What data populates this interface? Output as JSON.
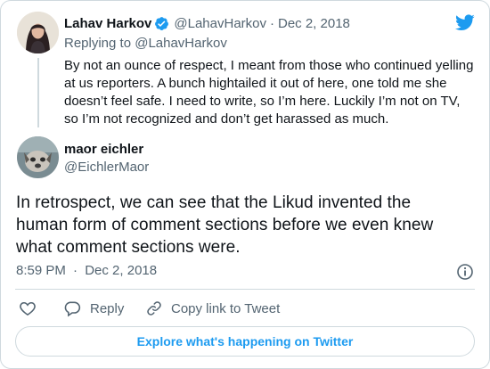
{
  "colors": {
    "verified_badge": "#1d9bf0",
    "twitter_blue": "#1d9bf0",
    "text_primary": "#0f1419",
    "text_muted": "#536471",
    "border": "#cfd9de"
  },
  "parent_tweet": {
    "author_name": "Lahav Harkov",
    "author_handle": "@LahavHarkov",
    "separator": "·",
    "date": "Dec 2, 2018",
    "replying_to": "Replying to @LahavHarkov",
    "text": "By not an ounce of respect, I meant from those who continued yelling at us reporters. A bunch hightailed it out of here, one told me she doesn’t feel safe. I need to write, so I’m here. Luckily I’m not on TV, so I’m not recognized and don’t get harassed as much."
  },
  "main_tweet": {
    "author_name": "maor eichler",
    "author_handle": "@EichlerMaor",
    "text": "In retrospect, we can see that the Likud invented the human form of comment sections before we even knew what comment sections were.",
    "time": "8:59 PM",
    "separator": "·",
    "date": "Dec 2, 2018"
  },
  "actions": {
    "reply_label": "Reply",
    "copy_link_label": "Copy link to Tweet"
  },
  "explore_label": "Explore what's happening on Twitter",
  "icons": [
    "twitter-bird-icon",
    "verified-badge-icon",
    "info-icon",
    "heart-icon",
    "reply-icon",
    "link-icon"
  ]
}
